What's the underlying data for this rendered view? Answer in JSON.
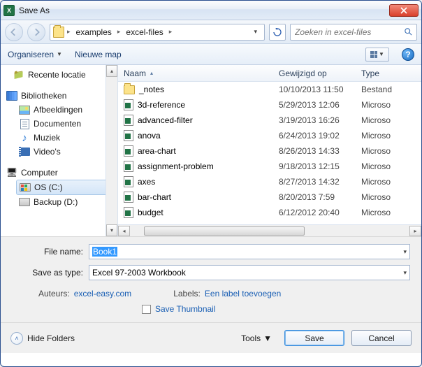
{
  "title": "Save As",
  "nav": {
    "crumb1": "examples",
    "crumb2": "excel-files"
  },
  "search": {
    "placeholder": "Zoeken in excel-files"
  },
  "toolbar": {
    "organize": "Organiseren",
    "newfolder": "Nieuwe map"
  },
  "sidebar": {
    "recent": "Recente locatie",
    "libraries": "Bibliotheken",
    "pictures": "Afbeeldingen",
    "documents": "Documenten",
    "music": "Muziek",
    "videos": "Video's",
    "computer": "Computer",
    "os": "OS (C:)",
    "backup": "Backup (D:)"
  },
  "columns": {
    "name": "Naam",
    "modified": "Gewijzigd op",
    "type": "Type"
  },
  "files": [
    {
      "icon": "folder",
      "name": "_notes",
      "date": "10/10/2013 11:50",
      "type": "Bestand"
    },
    {
      "icon": "xls",
      "name": "3d-reference",
      "date": "5/29/2013 12:06",
      "type": "Microso"
    },
    {
      "icon": "xls",
      "name": "advanced-filter",
      "date": "3/19/2013 16:26",
      "type": "Microso"
    },
    {
      "icon": "xls",
      "name": "anova",
      "date": "6/24/2013 19:02",
      "type": "Microso"
    },
    {
      "icon": "xls",
      "name": "area-chart",
      "date": "8/26/2013 14:33",
      "type": "Microso"
    },
    {
      "icon": "xls",
      "name": "assignment-problem",
      "date": "9/18/2013 12:15",
      "type": "Microso"
    },
    {
      "icon": "xls",
      "name": "axes",
      "date": "8/27/2013 14:32",
      "type": "Microso"
    },
    {
      "icon": "xls",
      "name": "bar-chart",
      "date": "8/20/2013 7:59",
      "type": "Microso"
    },
    {
      "icon": "xls",
      "name": "budget",
      "date": "6/12/2012 20:40",
      "type": "Microso"
    }
  ],
  "form": {
    "filename_label": "File name:",
    "filename_value": "Book1",
    "saveas_label": "Save as type:",
    "saveas_value": "Excel 97-2003 Workbook",
    "authors_k": "Auteurs:",
    "authors_v": "excel-easy.com",
    "labels_k": "Labels:",
    "labels_v": "Een label toevoegen",
    "save_thumb": "Save Thumbnail"
  },
  "footer": {
    "hide": "Hide Folders",
    "tools": "Tools",
    "save": "Save",
    "cancel": "Cancel"
  }
}
